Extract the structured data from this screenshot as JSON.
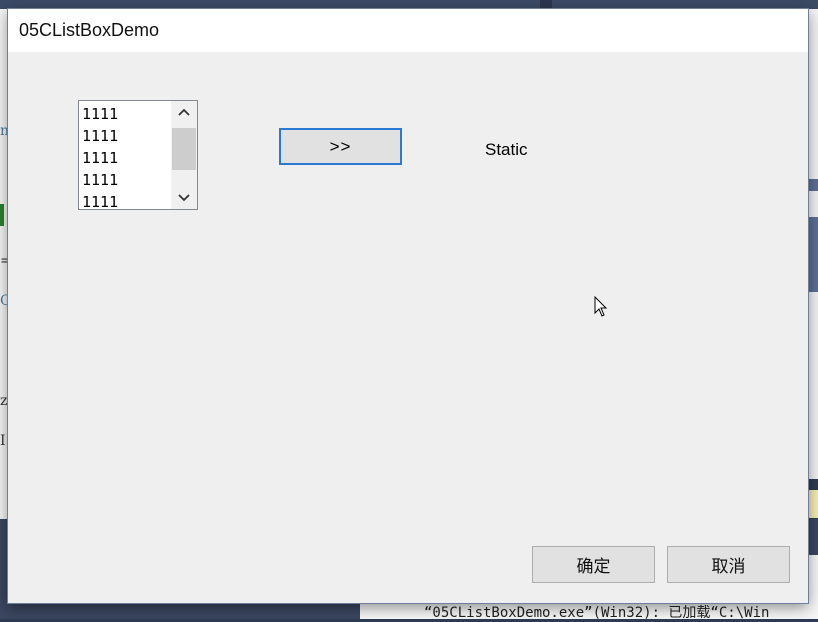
{
  "dialog": {
    "title": "05CListBoxDemo",
    "listbox": {
      "items": [
        "1111",
        "1111",
        "1111",
        "1111",
        "1111"
      ]
    },
    "move_button_label": ">>",
    "static_label": "Static",
    "ok_label": "确定",
    "cancel_label": "取消"
  },
  "background": {
    "output_line": "“05CListBoxDemo.exe”(Win32): 已加载“C:\\Win"
  },
  "icons": {
    "scroll_up": "chevron-up-icon",
    "scroll_down": "chevron-down-icon",
    "cursor": "mouse-pointer-icon"
  },
  "colors": {
    "dialog_bg": "#efefef",
    "button_bg": "#e1e1e1",
    "focus_border": "#2a7ad5",
    "ide_dark": "#3a4660"
  }
}
